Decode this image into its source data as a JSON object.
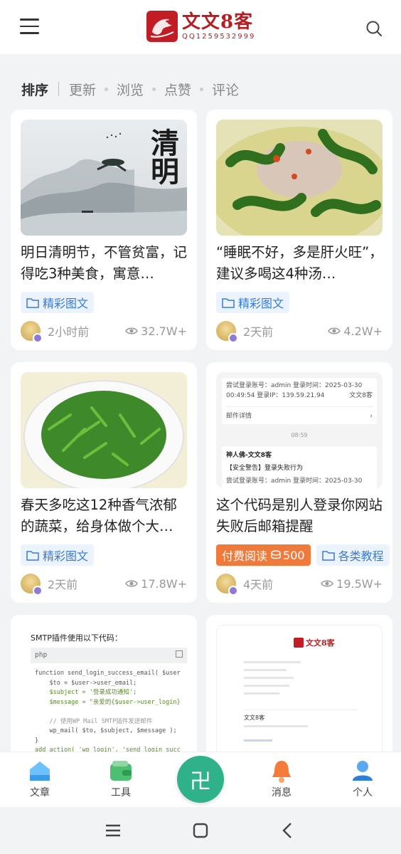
{
  "header": {
    "logo_name": "文文8客",
    "logo_qq": "QQ1259532999",
    "menu_icon": "menu-icon",
    "search_icon": "search-icon"
  },
  "sort_tabs": [
    "排序",
    "更新",
    "浏览",
    "点赞",
    "评论"
  ],
  "cards": [
    {
      "title": "明日清明节，不管贫富，记得吃3种美食，寓意…",
      "tags": [
        "精彩图文"
      ],
      "time": "2小时前",
      "views": "32.7W+",
      "thumb_text": "清明"
    },
    {
      "title": "“睡眠不好，多是肝火旺”，建议多喝这4种汤…",
      "tags": [
        "精彩图文"
      ],
      "time": "2天前",
      "views": "4.2W+"
    },
    {
      "title": "春天多吃这12种香气浓郁的蔬菜，给身体做个大…",
      "tags": [
        "精彩图文"
      ],
      "time": "2天前",
      "views": "17.8W+"
    },
    {
      "title": "这个代码是别人登录你网站失败后邮箱提醒",
      "paid_label": "付费阅读",
      "paid_amount": "500",
      "tags": [
        "各类教程"
      ],
      "time": "4天前",
      "views": "19.5W+",
      "thumb": {
        "line1": "尝试登录账号：admin 登录时间：2025-03-30",
        "line2": "00:49:54 登录IP：139.59.21.94",
        "line2_right": "文文8客",
        "detail": "邮件详情",
        "time_mid": "08:59",
        "sender": "神人佛-文文8客",
        "alert": "【安全警告】登录失败行为",
        "line3": "尝试登录账号：admin 登录时间：2025-03-30"
      }
    },
    {
      "thumb": {
        "heading": "SMTP插件使用以下代码：",
        "lang": "php",
        "code": [
          "function send_login_success_email( $user",
          "    $to = $user->user_email;",
          "    $subject = '登录成功通知';",
          "    $message = \"亲爱的{$user->user_login}",
          "",
          "    // 使用WP Mail SMTP插件发送邮件",
          "    wp_mail( $to, $subject, $message );",
          "}",
          "add_action( 'wp_login', 'send_login_succ"
        ]
      }
    },
    {
      "thumb": {
        "logo": "文文8客",
        "label": "文文8客"
      }
    }
  ],
  "tabbar": {
    "items": [
      "文章",
      "工具",
      "消息",
      "个人"
    ],
    "center_glyph": "卍"
  },
  "colors": {
    "brand_red": "#c21d24",
    "accent_green": "#2fb28a",
    "tag_blue": "#3a7bd5",
    "paid_orange": "#f07a3c"
  }
}
